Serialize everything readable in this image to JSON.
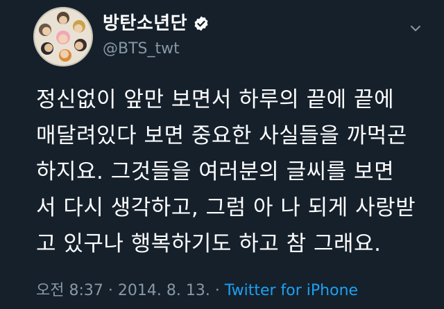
{
  "tweet": {
    "author": {
      "display_name": "방탄소년단",
      "handle": "@BTS_twt",
      "verified": true,
      "avatar_icon": "group-photo-avatar"
    },
    "text": "정신없이 앞만 보면서 하루의 끝에 끝에\n매달려있다 보면 중요한 사실들을 까먹곤\n하지요. 그것들을 여러분의 글씨를 보면\n서 다시 생각하고, 그럼 아 나 되게 사랑받\n고 있구나 행복하기도 하고 참 그래요.",
    "meta": {
      "time": "오전 8:37",
      "separator": " · ",
      "date": "2014. 8. 13.",
      "source": "Twitter for iPhone"
    }
  },
  "colors": {
    "background": "#15202b",
    "text": "#ffffff",
    "secondary_text": "#8899a6",
    "link": "#1da1f2"
  }
}
